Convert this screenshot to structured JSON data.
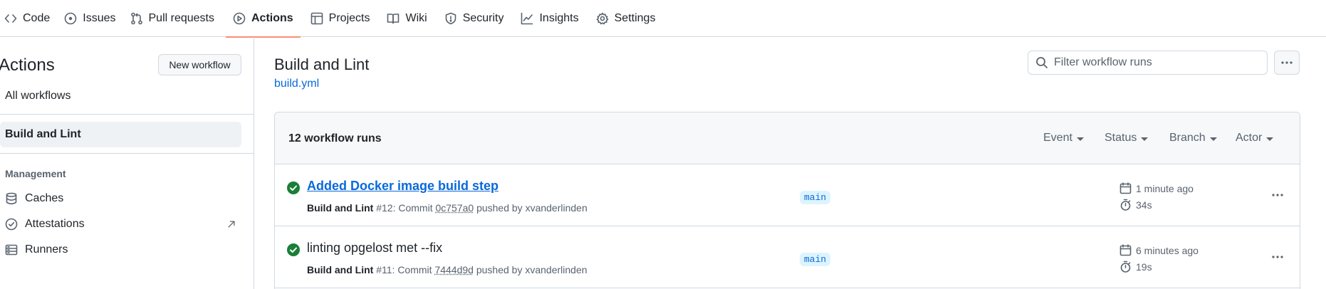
{
  "nav": {
    "tabs": [
      {
        "label": "Code",
        "icon": "code-icon"
      },
      {
        "label": "Issues",
        "icon": "issue-opened-icon"
      },
      {
        "label": "Pull requests",
        "icon": "git-pull-request-icon"
      },
      {
        "label": "Actions",
        "icon": "play-icon",
        "selected": true
      },
      {
        "label": "Projects",
        "icon": "table-icon"
      },
      {
        "label": "Wiki",
        "icon": "book-icon"
      },
      {
        "label": "Security",
        "icon": "shield-icon"
      },
      {
        "label": "Insights",
        "icon": "graph-icon"
      },
      {
        "label": "Settings",
        "icon": "gear-icon"
      }
    ],
    "selected_underline_color": "#fd8c73"
  },
  "sidebar": {
    "title": "Actions",
    "new_workflow_label": "New workflow",
    "all_workflows_label": "All workflows",
    "selected_workflow": "Build and Lint",
    "management_heading": "Management",
    "management_items": [
      {
        "label": "Caches",
        "icon": "database-icon"
      },
      {
        "label": "Attestations",
        "icon": "verified-icon",
        "external": true
      },
      {
        "label": "Runners",
        "icon": "server-icon"
      }
    ]
  },
  "main": {
    "workflow_title": "Build and Lint",
    "workflow_file": "build.yml",
    "filter_placeholder": "Filter workflow runs",
    "runs_count_label": "12 workflow runs",
    "filters": [
      "Event",
      "Status",
      "Branch",
      "Actor"
    ],
    "runs": [
      {
        "title": "Added Docker image build step",
        "title_is_link": true,
        "workflow": "Build and Lint",
        "number": "#12",
        "commit_prefix": ": Commit",
        "sha": "0c757a0",
        "pushed_by": "pushed by xvanderlinden",
        "branch": "main",
        "time_ago": "1 minute ago",
        "duration": "34s",
        "status": "success"
      },
      {
        "title": "linting opgelost met --fix",
        "title_is_link": false,
        "workflow": "Build and Lint",
        "number": "#11",
        "commit_prefix": ": Commit",
        "sha": "7444d9d",
        "pushed_by": "pushed by xvanderlinden",
        "branch": "main",
        "time_ago": "6 minutes ago",
        "duration": "19s",
        "status": "success"
      }
    ]
  },
  "colors": {
    "success": "#1a7f37",
    "link": "#0969da",
    "branch_bg": "#ddf4ff",
    "muted": "#59636e"
  }
}
